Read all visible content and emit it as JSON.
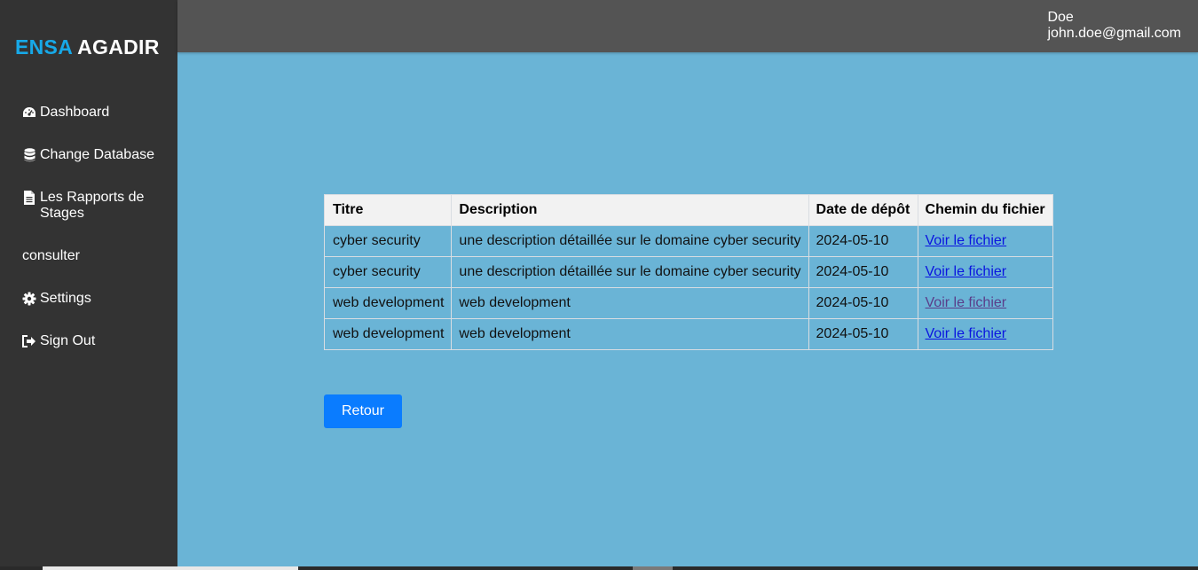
{
  "brand": {
    "part1": "ENSA",
    "part2": "AGADIR",
    "part1_color": "#17a9e8"
  },
  "sidebar": {
    "items": [
      {
        "label": "Dashboard",
        "icon": "dashboard-gauge-icon"
      },
      {
        "label": "Change Database",
        "icon": "database-icon"
      },
      {
        "label": "Les Rapports de Stages",
        "icon": "document-icon"
      },
      {
        "label": "consulter",
        "icon": ""
      },
      {
        "label": "Settings",
        "icon": "gear-icon"
      },
      {
        "label": "Sign Out",
        "icon": "sign-out-icon"
      }
    ]
  },
  "user": {
    "name": "Doe",
    "email": "john.doe@gmail.com"
  },
  "table": {
    "headers": [
      "Titre",
      "Description",
      "Date de dépôt",
      "Chemin du fichier"
    ],
    "rows": [
      {
        "titre": "cyber security",
        "description": "une description détaillée sur le domaine cyber security",
        "date": "2024-05-10",
        "link": "Voir le fichier"
      },
      {
        "titre": "cyber security",
        "description": "une description détaillée sur le domaine cyber security",
        "date": "2024-05-10",
        "link": "Voir le fichier"
      },
      {
        "titre": "web development",
        "description": "web development",
        "date": "2024-05-10",
        "link": "Voir le fichier"
      },
      {
        "titre": "web development",
        "description": "web development",
        "date": "2024-05-10",
        "link": "Voir le fichier"
      }
    ]
  },
  "buttons": {
    "back": "Retour"
  },
  "colors": {
    "page_bg": "#6ab4d6",
    "sidebar_bg": "#333333",
    "topbar_bg": "#545454",
    "button_bg": "#0a7cff",
    "link": "#0a14e0",
    "visited_link": "#5a3d8a"
  }
}
